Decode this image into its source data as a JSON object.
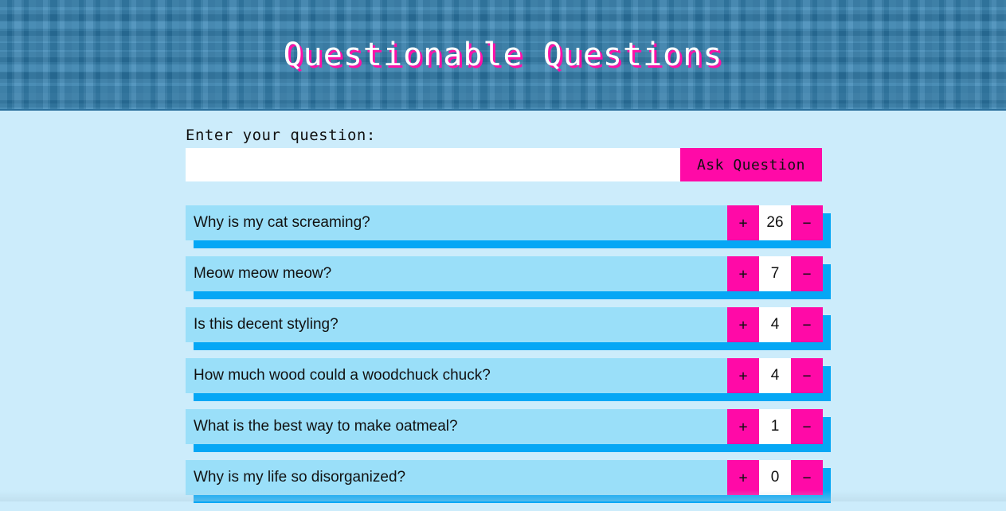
{
  "header": {
    "title": "Questionable Questions"
  },
  "form": {
    "label": "Enter your question:",
    "input_value": "",
    "input_placeholder": "",
    "submit_label": "Ask Question"
  },
  "questions": [
    {
      "text": "Why is my cat screaming?",
      "votes": "26",
      "upvote_label": "+",
      "downvote_label": "−"
    },
    {
      "text": "Meow meow meow?",
      "votes": "7",
      "upvote_label": "+",
      "downvote_label": "−"
    },
    {
      "text": "Is this decent styling?",
      "votes": "4",
      "upvote_label": "+",
      "downvote_label": "−"
    },
    {
      "text": "How much wood could a woodchuck chuck?",
      "votes": "4",
      "upvote_label": "+",
      "downvote_label": "−"
    },
    {
      "text": "What is the best way to make oatmeal?",
      "votes": "1",
      "upvote_label": "+",
      "downvote_label": "−"
    },
    {
      "text": "Why is my life so disorganized?",
      "votes": "0",
      "upvote_label": "+",
      "downvote_label": "−"
    }
  ],
  "colors": {
    "header_bg": "#2f7fb0",
    "page_bg": "#ccecfb",
    "accent_pink": "#ff0aa7",
    "row_bg": "#9adff9",
    "row_shadow": "#05a7f5"
  }
}
